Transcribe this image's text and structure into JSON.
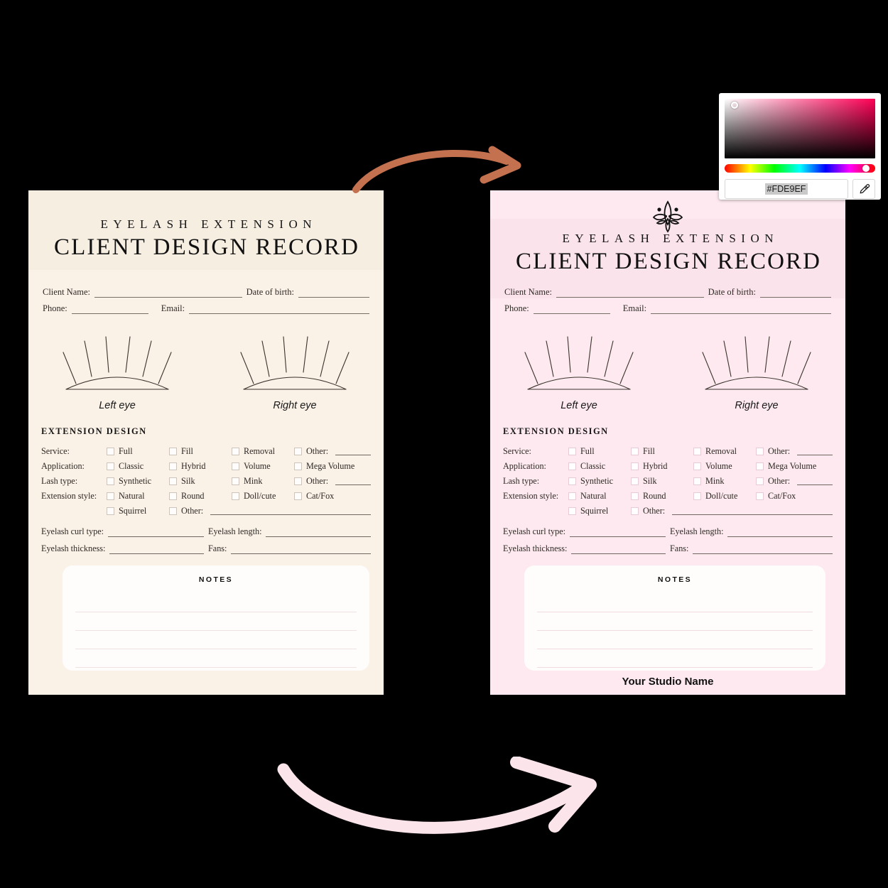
{
  "colors": {
    "before_bg": "#FAF1E7",
    "after_bg": "#FDE9EF",
    "picked_hex": "#FDE9EF",
    "arrow_top": "#C4714F",
    "arrow_bottom": "#FBE5EA"
  },
  "document": {
    "kicker": "EYELASH EXTENSION",
    "headline": "CLIENT DESIGN RECORD",
    "client_info": [
      {
        "label": "Client Name:",
        "value": ""
      },
      {
        "label": "Date of birth:",
        "value": ""
      },
      {
        "label": "Phone:",
        "value": ""
      },
      {
        "label": "Email:",
        "value": ""
      }
    ],
    "eyes": [
      {
        "caption": "Left eye"
      },
      {
        "caption": "Right eye"
      }
    ],
    "extension_design": {
      "section_title": "EXTENSION DESIGN",
      "rows": [
        {
          "label": "Service:",
          "options": [
            "Full",
            "Classic"
          ],
          "cells": [
            "Full",
            "Fill",
            "Removal",
            "Other:"
          ],
          "other_line": true
        },
        {
          "label": "Application:",
          "cells": [
            "Classic",
            "Hybrid",
            "Volume",
            "Mega Volume"
          ],
          "other_line": false
        },
        {
          "label": "Lash type:",
          "cells": [
            "Synthetic",
            "Silk",
            "Mink",
            "Other:"
          ],
          "other_line": true
        },
        {
          "label": "Extension style:",
          "cells": [
            "Natural",
            "Round",
            "Doll/cute",
            "Cat/Fox"
          ],
          "other_line": false
        },
        {
          "label": "",
          "cells": [
            "Squirrel",
            "Other:"
          ],
          "other_line": true
        }
      ],
      "detail_fields": [
        {
          "label": "Eyelash curl type:",
          "value": ""
        },
        {
          "label": "Eyelash length:",
          "value": ""
        },
        {
          "label": "Eyelash thickness:",
          "value": ""
        },
        {
          "label": "Fans:",
          "value": ""
        }
      ]
    },
    "notes": {
      "title": "NOTES",
      "line_count": 4
    },
    "studio_name": "Your Studio Name"
  },
  "color_picker": {
    "hex_value": "#FDE9EF",
    "eyedropper_label": "eyedropper"
  }
}
